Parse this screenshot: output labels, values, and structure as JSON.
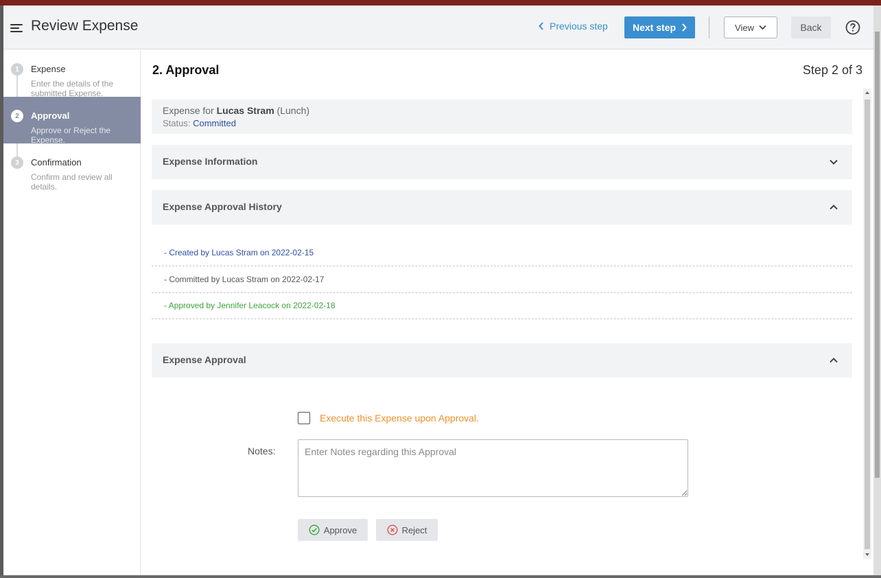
{
  "header": {
    "title": "Review Expense",
    "prev_label": "Previous step",
    "next_label": "Next step",
    "view_label": "View",
    "back_label": "Back"
  },
  "sidebar": {
    "steps": [
      {
        "number": "1",
        "label": "Expense",
        "desc": "Enter the details of the submitted Expense."
      },
      {
        "number": "2",
        "label": "Approval",
        "desc": "Approve or Reject the Expense."
      },
      {
        "number": "3",
        "label": "Confirmation",
        "desc": "Confirm and review all details."
      }
    ]
  },
  "main": {
    "title": "2. Approval",
    "step_count": "Step 2 of 3",
    "summary": {
      "prefix": "Expense for",
      "name": "Lucas Stram",
      "category": "(Lunch)",
      "status_label": "Status:",
      "status_value": "Committed"
    },
    "panels": {
      "info": "Expense Information",
      "history": "Expense Approval History",
      "approval": "Expense Approval"
    },
    "history": [
      {
        "text": "- Created by Lucas Stram on 2022-02-15",
        "color": "#2f4e9e"
      },
      {
        "text": "- Committed by Lucas Stram on 2022-02-17",
        "color": "#555555"
      },
      {
        "text": "- Approved by Jennifer Leacock on 2022-02-18",
        "color": "#3ca33c"
      }
    ],
    "approval": {
      "checkbox_label": "Execute this Expense upon Approval.",
      "notes_label": "Notes:",
      "notes_placeholder": "Enter Notes regarding this Approval",
      "notes_value": "",
      "approve_label": "Approve",
      "reject_label": "Reject"
    }
  },
  "colors": {
    "accent": "#3a8fd0",
    "active_step": "#848ca3",
    "warning_text": "#f0902a",
    "approve_icon": "#3ca33c",
    "reject_icon": "#e05050"
  },
  "icons": {
    "menu": "menu-icon",
    "prev": "chevron-left-icon",
    "next": "chevron-right-icon",
    "view": "chevron-down-icon",
    "help": "question-circle-icon",
    "approve": "check-circle-icon",
    "reject": "x-circle-icon"
  }
}
